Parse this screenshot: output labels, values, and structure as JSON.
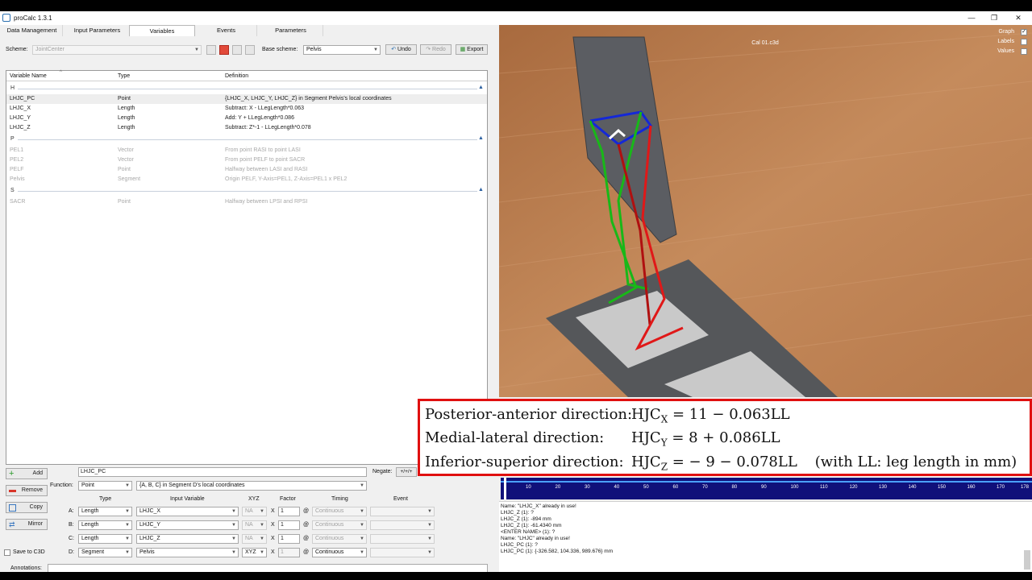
{
  "app": {
    "title": "proCalc 1.3.1"
  },
  "tabs": [
    "Data Management",
    "Input Parameters",
    "Variables",
    "Events",
    "Parameters"
  ],
  "active_tab": "Variables",
  "toolbar": {
    "scheme_label": "Scheme:",
    "scheme_value": "JointCenter",
    "base_scheme_label": "Base scheme:",
    "base_scheme_value": "Pelvis",
    "undo_label": "Undo",
    "redo_label": "Redo",
    "export_label": "Export"
  },
  "grid": {
    "headers": {
      "name": "Variable Name",
      "type": "Type",
      "definition": "Definition"
    },
    "groups": [
      {
        "label": "H",
        "rows": [
          {
            "name": "LHJC_PC",
            "type": "Point",
            "definition": "{LHJC_X, LHJC_Y, LHJC_Z} in Segment Pelvis's local coordinates",
            "selected": true,
            "dim": false
          },
          {
            "name": "LHJC_X",
            "type": "Length",
            "definition": "Subtract: X - LLegLength*0.063",
            "selected": false,
            "dim": false
          },
          {
            "name": "LHJC_Y",
            "type": "Length",
            "definition": "Add: Y + LLegLength*0.086",
            "selected": false,
            "dim": false
          },
          {
            "name": "LHJC_Z",
            "type": "Length",
            "definition": "Subtract: Z*-1 - LLegLength*0.078",
            "selected": false,
            "dim": false
          }
        ]
      },
      {
        "label": "P",
        "rows": [
          {
            "name": "PEL1",
            "type": "Vector",
            "definition": "From point RASI to point LASI",
            "selected": false,
            "dim": true
          },
          {
            "name": "PEL2",
            "type": "Vector",
            "definition": "From point PELF to point SACR",
            "selected": false,
            "dim": true
          },
          {
            "name": "PELF",
            "type": "Point",
            "definition": "Halfway between LASI and RASI",
            "selected": false,
            "dim": true
          },
          {
            "name": "Pelvis",
            "type": "Segment",
            "definition": "Origin PELF, Y-Axis=PEL1, Z-Axis=PEL1 x PEL2",
            "selected": false,
            "dim": true
          }
        ]
      },
      {
        "label": "S",
        "rows": [
          {
            "name": "SACR",
            "type": "Point",
            "definition": "Halfway between LPSI and RPSI",
            "selected": false,
            "dim": true
          }
        ]
      }
    ]
  },
  "editor": {
    "add_label": "Add",
    "remove_label": "Remove",
    "copy_label": "Copy",
    "mirror_label": "Mirror",
    "save_c3d_label": "Save to C3D",
    "name_value": "LHJC_PC",
    "negate_label": "Negate:",
    "negate_value": "+/+/+",
    "function_label": "Function:",
    "function_value": "Point",
    "function_desc": "{A, B, C} in Segment D's local coordinates",
    "col_headers": {
      "type": "Type",
      "input": "Input Variable",
      "xyz": "XYZ",
      "factor": "Factor",
      "timing": "Timing",
      "event": "Event"
    },
    "params": [
      {
        "letter": "A:",
        "type": "Length",
        "input": "LHJC_X",
        "xyz": "NA",
        "factor": "1",
        "timing": "Continuous"
      },
      {
        "letter": "B:",
        "type": "Length",
        "input": "LHJC_Y",
        "xyz": "NA",
        "factor": "1",
        "timing": "Continuous"
      },
      {
        "letter": "C:",
        "type": "Length",
        "input": "LHJC_Z",
        "xyz": "NA",
        "factor": "1",
        "timing": "Continuous"
      },
      {
        "letter": "D:",
        "type": "Segment",
        "input": "Pelvis",
        "xyz": "XYZ",
        "factor": "1",
        "timing": "Continuous"
      }
    ],
    "x_sym": "X",
    "at_sym": "@",
    "annotations_label": "Annotations:"
  },
  "viewport": {
    "file_title": "Cal 01.c3d",
    "options": [
      {
        "label": "Graph",
        "checked": true
      },
      {
        "label": "Labels",
        "checked": false
      },
      {
        "label": "Values",
        "checked": false
      }
    ]
  },
  "overlay": {
    "lines": [
      {
        "label": "Posterior-anterior direction:",
        "sym": "HJC",
        "sub": "X",
        "rhs": " = 11  −  0.063LL",
        "note": ""
      },
      {
        "label": "Medial-lateral direction:",
        "sym": "HJC",
        "sub": "Y",
        "rhs": " = 8 + 0.086LL",
        "note": ""
      },
      {
        "label": "Inferior-superior direction:",
        "sym": "HJC",
        "sub": "Z",
        "rhs": " = − 9  −  0.078LL",
        "note": "(with LL: leg length in mm)"
      }
    ]
  },
  "timeline": {
    "ticks": [
      "10",
      "20",
      "30",
      "40",
      "50",
      "60",
      "70",
      "80",
      "90",
      "100",
      "110",
      "120",
      "130",
      "140",
      "150",
      "160",
      "170",
      "178"
    ]
  },
  "console": {
    "lines": [
      "Name: \"LHJC_X\" already in use!",
      "LHJC_Z (1): ?",
      "LHJC_Z (1): -894 mm",
      "LHJC_Z (1): -61.4340 mm",
      "<ENTER NAME> (1): ?",
      "Name: \"LHJC\" already in use!",
      "LHJC_PC (1): ?",
      "LHJC_PC (1): {-326.582, 104.336, 989.676} mm"
    ]
  },
  "colors": {
    "overlay_border": "#e01010",
    "timeline_bg": "#10107a",
    "floor": "#b9784a"
  }
}
